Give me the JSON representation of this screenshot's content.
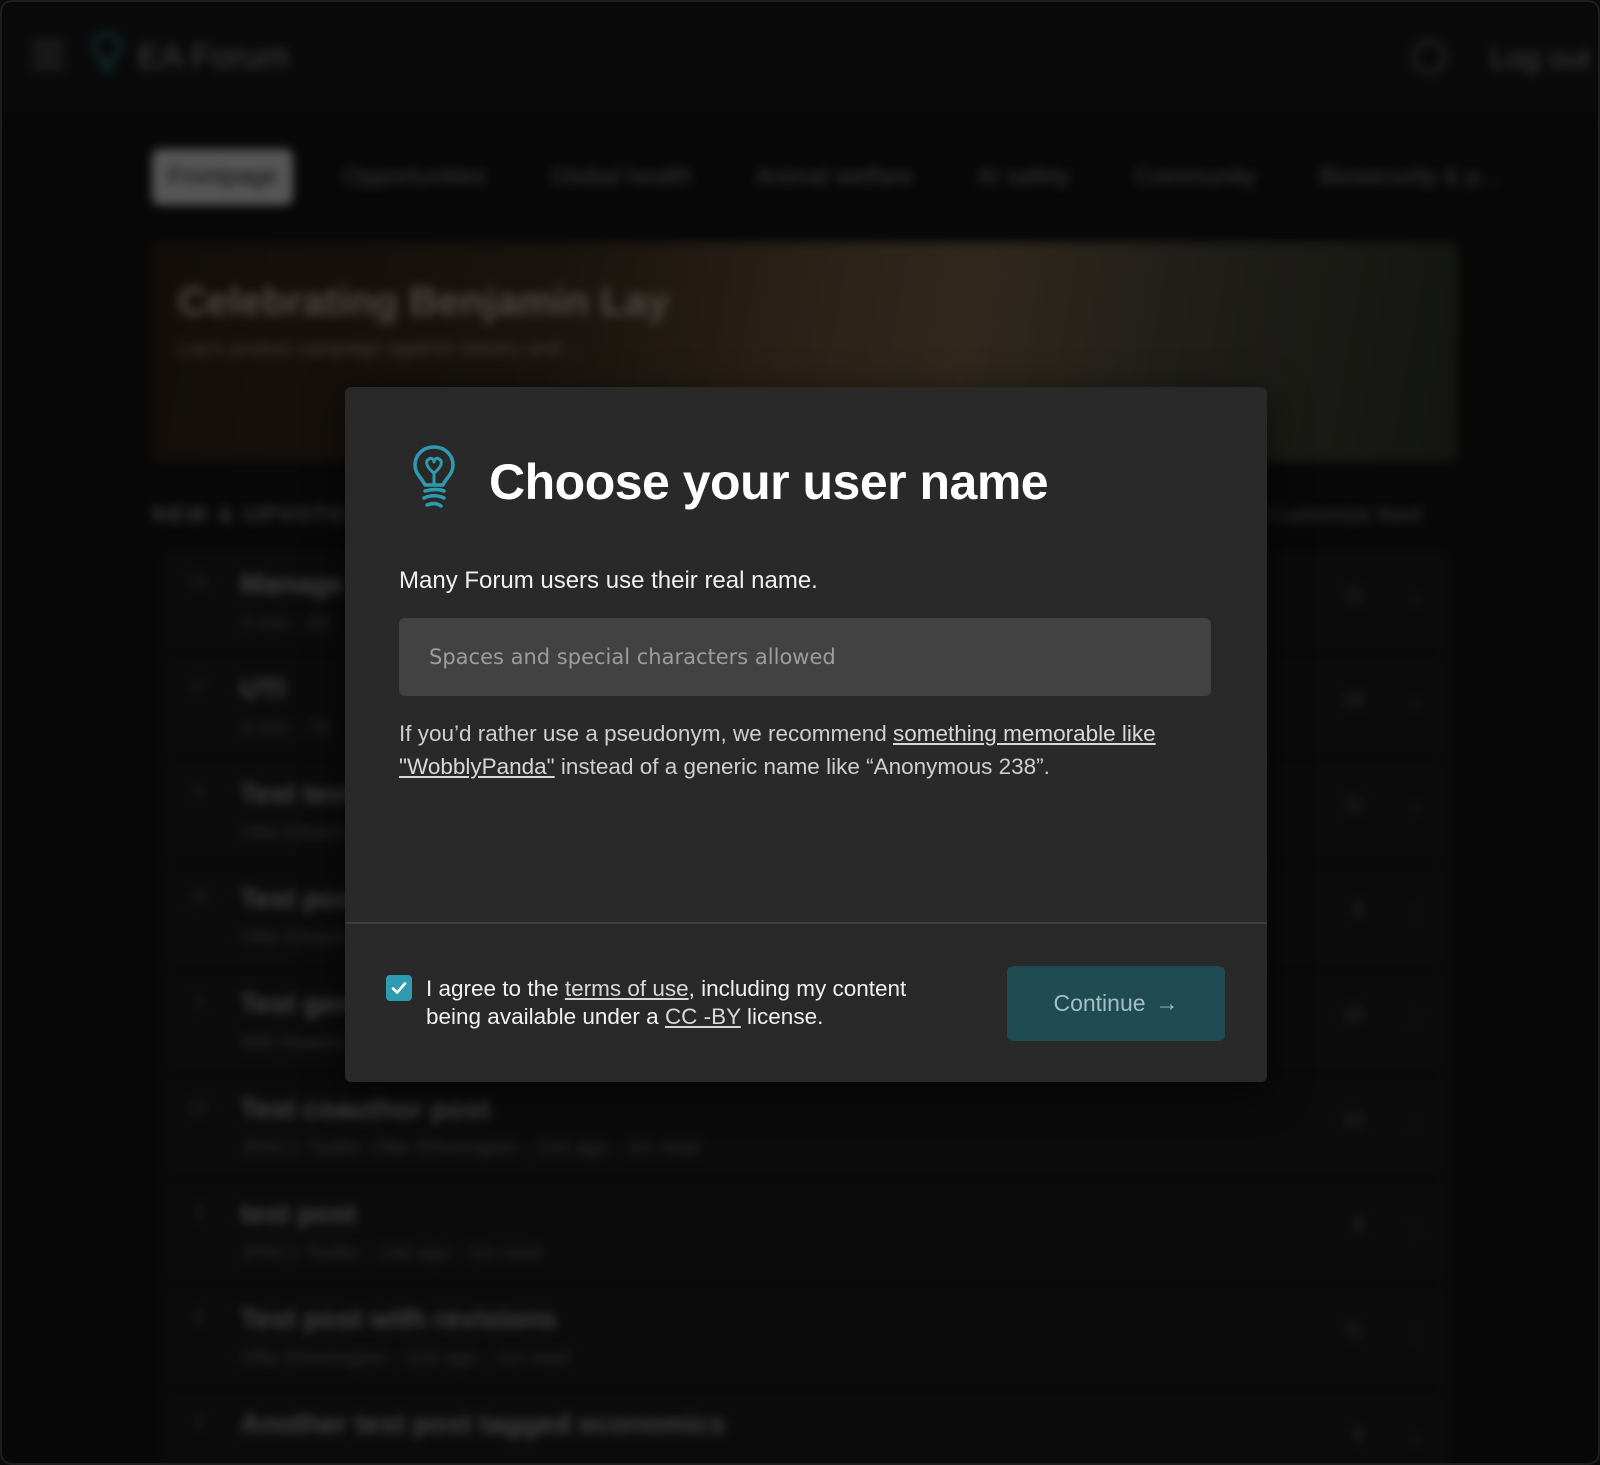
{
  "header": {
    "site_name": "EA Forum",
    "login_label": "Log out"
  },
  "tabs": [
    {
      "label": "Frontpage"
    },
    {
      "label": "Opportunities"
    },
    {
      "label": "Global health"
    },
    {
      "label": "Animal welfare"
    },
    {
      "label": "AI safety"
    },
    {
      "label": "Community"
    },
    {
      "label": "Biosecurity & p..."
    }
  ],
  "banner": {
    "title": "Celebrating Benjamin Lay",
    "subtitle": "Lay's protest campaign against slavery and ..."
  },
  "posts_section": {
    "label": "NEW & UPVOTED",
    "right_label": "Customize feed",
    "posts": [
      {
        "votes": "23",
        "title": "Manage",
        "meta": "3 min · 2d",
        "comments": "11"
      },
      {
        "votes": "17",
        "title": "UTI",
        "meta": "3 min · 7d",
        "comments": "18"
      },
      {
        "votes": "9",
        "title": "Test text",
        "meta": "Ollie Etherington",
        "comments": "11"
      },
      {
        "votes": "10",
        "title": "Test post",
        "meta": "Ollie Etherington",
        "comments": "8"
      },
      {
        "votes": "3",
        "title": "Test gen",
        "meta": "Will Howard",
        "comments": "10"
      },
      {
        "votes": "10",
        "title": "Test coauthor post",
        "meta": "JPAC1 Tsafer, Ollie Etherington · 21d ago · 1m read",
        "comments": "10"
      },
      {
        "votes": "3",
        "title": "test post",
        "meta": "JPAC1 Tsafer · 14d ago · 1m read",
        "comments": "8"
      },
      {
        "votes": "9",
        "title": "Test post with revisions",
        "meta": "Ollie Etherington · 22d ago · 1m read",
        "comments": "11"
      },
      {
        "votes": "4",
        "title": "Another test post tagged economics",
        "meta": "",
        "comments": "6"
      }
    ]
  },
  "modal": {
    "title": "Choose your user name",
    "subtitle": "Many Forum users use their real name.",
    "input": {
      "value": "",
      "placeholder": "Spaces and special characters allowed"
    },
    "hint": {
      "prefix": "If you’d rather use a pseudonym, we recommend ",
      "link": "something memorable like \"WobblyPanda\"",
      "suffix": " instead of a generic name like “Anonymous 238”."
    },
    "agreement": {
      "checked": true,
      "part1": "I agree to the ",
      "terms_link": "terms of use",
      "part2": ", including my content being available under a ",
      "license_link": "CC -BY",
      "part3": " license."
    },
    "continue_label": "Continue",
    "continue_arrow": "→"
  },
  "colors": {
    "accent": "#2f9bb0",
    "button_bg": "#1f4b53",
    "modal_bg": "#292929",
    "input_bg": "#424242"
  }
}
